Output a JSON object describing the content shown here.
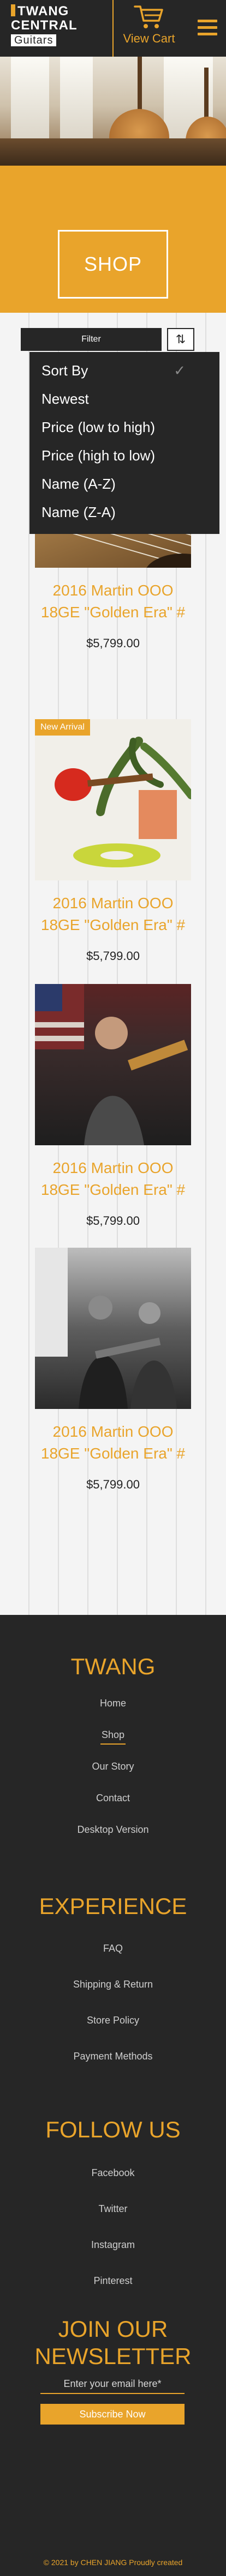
{
  "header": {
    "logo_line1": "TWANG",
    "logo_line2": "CENTRAL",
    "logo_line3": "Guitars",
    "cart_label": "View Cart",
    "cart_icon": "cart-icon",
    "menu_icon": "hamburger-menu-icon"
  },
  "banner": {
    "title": "SHOP"
  },
  "filters": {
    "filter_label": "Filter",
    "sort_icon": "sort-arrows-icon",
    "sort_options": [
      "Sort By",
      "Newest",
      "Price (low to high)",
      "Price (high to low)",
      "Name (A-Z)",
      "Name (Z-A)"
    ],
    "selected_check": "✓"
  },
  "products": [
    {
      "title_line1": "2016 Martin OOO",
      "title_line2": "18GE \"Golden Era\" #",
      "price": "$5,799.00",
      "badge": ""
    },
    {
      "title_line1": "2016 Martin OOO",
      "title_line2": "18GE \"Golden Era\" #",
      "price": "$5,799.00",
      "badge": "New Arrival"
    },
    {
      "title_line1": "2016 Martin OOO",
      "title_line2": "18GE \"Golden Era\" #",
      "price": "$5,799.00",
      "badge": ""
    },
    {
      "title_line1": "2016 Martin OOO",
      "title_line2": "18GE \"Golden Era\" #",
      "price": "$5,799.00",
      "badge": ""
    }
  ],
  "footer": {
    "brand_title": "TWANG",
    "brand_links": [
      "Home",
      "Shop",
      "Our Story",
      "Contact",
      "Desktop Version"
    ],
    "experience_title": "EXPERIENCE",
    "experience_links": [
      "FAQ",
      "Shipping & Return",
      "Store Policy",
      "Payment Methods"
    ],
    "follow_title": "FOLLOW US",
    "follow_links": [
      "Facebook",
      "Twitter",
      "Instagram",
      "Pinterest"
    ],
    "newsletter_title_line1": "JOIN OUR",
    "newsletter_title_line2": "NEWSLETTER",
    "email_placeholder": "Enter your email here*",
    "subscribe_label": "Subscribe Now",
    "copyright": "© 2021 by CHEN JIANG Proudly created"
  },
  "colors": {
    "accent": "#e9a42b",
    "dark": "#262626"
  }
}
